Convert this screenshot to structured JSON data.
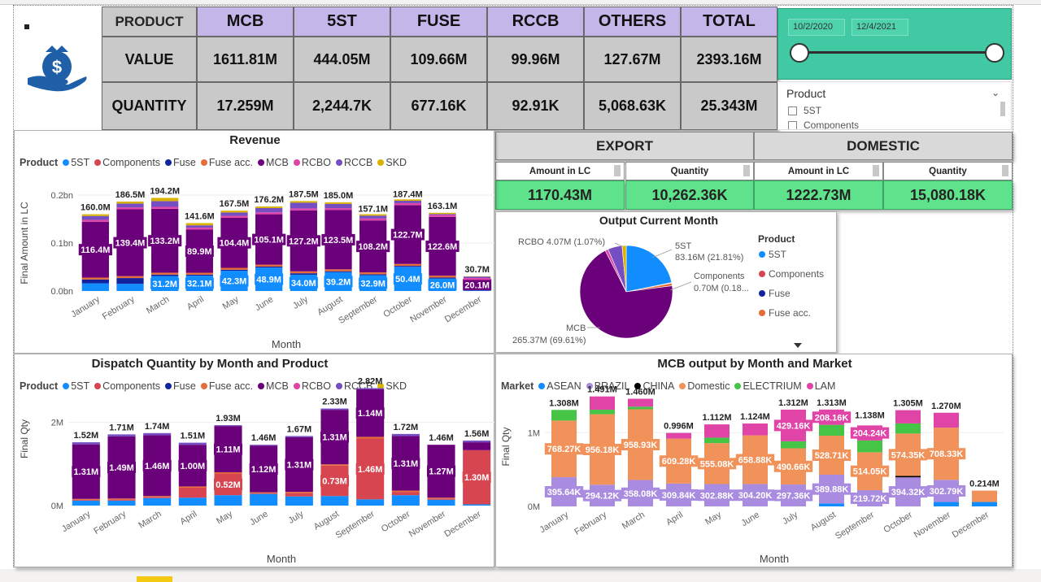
{
  "kpi": {
    "columns": [
      "PRODUCT",
      "MCB",
      "5ST",
      "FUSE",
      "RCCB",
      "OTHERS",
      "TOTAL"
    ],
    "rows": [
      {
        "label": "VALUE",
        "values": [
          "1611.81M",
          "444.05M",
          "109.66M",
          "99.96M",
          "127.67M",
          "2393.16M"
        ]
      },
      {
        "label": "QUANTITY",
        "values": [
          "17.259M",
          "2,244.7K",
          "677.16K",
          "92.91K",
          "5,068.63K",
          "25.343M"
        ]
      }
    ]
  },
  "date_slicer": {
    "start": "10/2/2020",
    "end": "12/4/2021"
  },
  "product_slicer": {
    "title": "Product",
    "items": [
      "5ST",
      "Components"
    ]
  },
  "export_domestic": {
    "export": {
      "title": "EXPORT",
      "amount_label": "Amount in LC",
      "quantity_label": "Quantity",
      "amount": "1170.43M",
      "quantity": "10,262.36K"
    },
    "domestic": {
      "title": "DOMESTIC",
      "amount_label": "Amount in LC",
      "quantity_label": "Quantity",
      "amount": "1222.73M",
      "quantity": "15,080.18K"
    }
  },
  "colors": {
    "5ST": "#118dff",
    "Components": "#d64550",
    "Fuse": "#12239e",
    "Fuse acc.": "#e66c37",
    "MCB": "#6b007b",
    "RCBO": "#e044a7",
    "RCCB": "#744ec2",
    "SKD": "#d9b300",
    "ASEAN": "#118dff",
    "BRAZIL": "#a98ce0",
    "CHINA": "#000000",
    "Domestic": "#f0925a",
    "ELECTRIUM": "#45c446",
    "LAM": "#e044a7"
  },
  "legend_product": {
    "title": "Product",
    "items": [
      "5ST",
      "Components",
      "Fuse",
      "Fuse acc.",
      "MCB",
      "RCBO",
      "RCCB",
      "SKD"
    ]
  },
  "legend_market": {
    "title": "Market",
    "items": [
      "ASEAN",
      "BRAZIL",
      "CHINA",
      "Domestic",
      "ELECTRIUM",
      "LAM"
    ]
  },
  "chart_data": [
    {
      "id": "revenue",
      "type": "bar",
      "title": "Revenue",
      "xlabel": "Month",
      "ylabel": "Final Amount in LC",
      "yticks": [
        "0.0bn",
        "0.1bn",
        "0.2bn"
      ],
      "ylim": [
        0,
        0.2
      ],
      "categories": [
        "January",
        "February",
        "March",
        "April",
        "May",
        "June",
        "July",
        "August",
        "September",
        "October",
        "November",
        "December"
      ],
      "totals": [
        "160.0M",
        "186.5M",
        "194.2M",
        "141.6M",
        "167.5M",
        "176.2M",
        "187.5M",
        "185.0M",
        "157.1M",
        "187.4M",
        "163.1M",
        "30.7M"
      ],
      "total_values": [
        0.16,
        0.1865,
        0.1942,
        0.1416,
        0.1675,
        0.1762,
        0.1875,
        0.185,
        0.1571,
        0.1874,
        0.1631,
        0.0307
      ],
      "series": [
        {
          "name": "5ST",
          "values": [
            0.016,
            0.015,
            0.0312,
            0.0321,
            0.0423,
            0.0489,
            0.034,
            0.0392,
            0.0329,
            0.0504,
            0.026,
            0.003
          ],
          "labels": [
            "",
            "",
            "31.2M",
            "32.1M",
            "42.3M",
            "48.9M",
            "34.0M",
            "39.2M",
            "32.9M",
            "50.4M",
            "26.0M",
            ""
          ]
        },
        {
          "name": "Fuse",
          "values": [
            0.008,
            0.012,
            0.003,
            0.002,
            0.002,
            0.002,
            0.003,
            0.002,
            0.002,
            0.002,
            0.002,
            0.0
          ],
          "labels": []
        },
        {
          "name": "Fuse acc.",
          "values": [
            0.004,
            0.004,
            0.004,
            0.004,
            0.004,
            0.004,
            0.004,
            0.004,
            0.004,
            0.004,
            0.004,
            0.0
          ],
          "labels": []
        },
        {
          "name": "MCB",
          "values": [
            0.1164,
            0.1394,
            0.1332,
            0.0899,
            0.1044,
            0.1051,
            0.1272,
            0.1235,
            0.1082,
            0.1227,
            0.1226,
            0.0201
          ],
          "labels": [
            "116.4M",
            "139.4M",
            "133.2M",
            "89.9M",
            "104.4M",
            "105.1M",
            "127.2M",
            "123.5M",
            "108.2M",
            "122.7M",
            "122.6M",
            "20.1M"
          ]
        },
        {
          "name": "RCBO",
          "values": [
            0.004,
            0.004,
            0.004,
            0.004,
            0.004,
            0.004,
            0.004,
            0.004,
            0.004,
            0.004,
            0.004,
            0.004
          ],
          "labels": []
        },
        {
          "name": "RCCB",
          "values": [
            0.008,
            0.008,
            0.012,
            0.005,
            0.007,
            0.009,
            0.012,
            0.009,
            0.006,
            0.005,
            0.002,
            0.003
          ],
          "labels": []
        },
        {
          "name": "SKD",
          "values": [
            0.0036,
            0.0041,
            0.0068,
            0.0046,
            0.0038,
            0.0032,
            0.0033,
            0.0033,
            0.003,
            0.0029,
            0.0025,
            0.0006
          ],
          "labels": []
        }
      ]
    },
    {
      "id": "dispatch",
      "type": "bar",
      "title": "Dispatch Quantity by Month and Product",
      "xlabel": "Month",
      "ylabel": "Final Qty",
      "yticks": [
        "0M",
        "2M"
      ],
      "ylim": [
        0,
        3.2
      ],
      "categories": [
        "January",
        "February",
        "March",
        "April",
        "May",
        "June",
        "July",
        "August",
        "September",
        "October",
        "November",
        "December"
      ],
      "totals": [
        "1.52M",
        "1.71M",
        "1.74M",
        "1.51M",
        "1.93M",
        "1.46M",
        "1.67M",
        "2.33M",
        "2.82M",
        "1.72M",
        "1.46M",
        "1.56M"
      ],
      "total_values": [
        1.52,
        1.71,
        1.74,
        1.51,
        1.93,
        1.46,
        1.67,
        2.33,
        2.82,
        1.72,
        1.46,
        1.56
      ],
      "series": [
        {
          "name": "5ST",
          "values": [
            0.12,
            0.12,
            0.18,
            0.19,
            0.25,
            0.28,
            0.22,
            0.23,
            0.15,
            0.25,
            0.14,
            0.03
          ],
          "labels": []
        },
        {
          "name": "Components",
          "values": [
            0.02,
            0.03,
            0.03,
            0.24,
            0.52,
            0.02,
            0.08,
            0.73,
            1.46,
            0.08,
            0.03,
            1.3
          ],
          "labels": [
            "",
            "",
            "",
            "",
            "0.52M",
            "",
            "",
            "0.73M",
            "1.46M",
            "",
            "",
            "1.30M"
          ]
        },
        {
          "name": "Fuse acc.",
          "values": [
            0.02,
            0.02,
            0.02,
            0.03,
            0.03,
            0.02,
            0.03,
            0.03,
            0.04,
            0.03,
            0.02,
            0.0
          ],
          "labels": []
        },
        {
          "name": "MCB",
          "values": [
            1.31,
            1.49,
            1.46,
            1.0,
            1.11,
            1.12,
            1.31,
            1.31,
            1.14,
            1.31,
            1.27,
            0.19
          ],
          "labels": [
            "1.31M",
            "1.49M",
            "1.46M",
            "1.00M",
            "1.11M",
            "1.12M",
            "1.31M",
            "1.31M",
            "1.14M",
            "1.31M",
            "1.27M",
            ""
          ]
        },
        {
          "name": "RCCB",
          "values": [
            0.05,
            0.05,
            0.05,
            0.05,
            0.02,
            0.02,
            0.03,
            0.03,
            0.03,
            0.05,
            0.0,
            0.04
          ],
          "labels": []
        }
      ]
    },
    {
      "id": "mcb_market",
      "type": "bar",
      "title": "MCB output by Month and Market",
      "xlabel": "Month",
      "ylabel": "Final Qty",
      "yticks": [
        "0M",
        "1M"
      ],
      "ylim": [
        0,
        1.62
      ],
      "categories": [
        "January",
        "February",
        "March",
        "April",
        "May",
        "June",
        "July",
        "August",
        "September",
        "October",
        "November",
        "December"
      ],
      "totals": [
        "1.308M",
        "1.491M",
        "1.460M",
        "0.996M",
        "1.112M",
        "1.124M",
        "1.312M",
        "1.313M",
        "1.138M",
        "1.305M",
        "1.270M",
        "0.214M"
      ],
      "total_values": [
        1.308,
        1.491,
        1.46,
        0.996,
        1.112,
        1.124,
        1.312,
        1.313,
        1.138,
        1.305,
        1.27,
        0.214
      ],
      "series": [
        {
          "name": "ASEAN",
          "values": [
            0.0,
            0.0,
            0.0,
            0.0,
            0.0,
            0.0,
            0.0,
            0.04,
            0.0,
            0.0,
            0.06,
            0.06
          ],
          "labels": []
        },
        {
          "name": "BRAZIL",
          "values": [
            0.396,
            0.294,
            0.358,
            0.31,
            0.303,
            0.304,
            0.297,
            0.39,
            0.22,
            0.394,
            0.3,
            0.0
          ],
          "labels": [
            "395.64K",
            "294.12K",
            "358.08K",
            "309.84K",
            "302.88K",
            "304.20K",
            "297.36K",
            "389.88K",
            "219.72K",
            "394.32K",
            "302.79K",
            ""
          ]
        },
        {
          "name": "CHINA",
          "values": [
            0.0,
            0.0,
            0.0,
            0.0,
            0.0,
            0.0,
            0.0,
            0.0,
            0.0,
            0.02,
            0.0,
            0.0
          ],
          "labels": []
        },
        {
          "name": "Domestic",
          "values": [
            0.768,
            0.956,
            0.959,
            0.609,
            0.555,
            0.659,
            0.491,
            0.529,
            0.514,
            0.574,
            0.708,
            0.154
          ],
          "labels": [
            "768.27K",
            "956.18K",
            "958.93K",
            "609.28K",
            "555.08K",
            "658.88K",
            "490.66K",
            "528.71K",
            "514.05K",
            "574.35K",
            "708.33K",
            ""
          ]
        },
        {
          "name": "ELECTRIUM",
          "values": [
            0.144,
            0.061,
            0.035,
            0.0,
            0.074,
            0.0,
            0.095,
            0.146,
            0.16,
            0.137,
            0.0,
            0.0
          ],
          "labels": []
        },
        {
          "name": "LAM",
          "values": [
            0.0,
            0.18,
            0.108,
            0.077,
            0.18,
            0.161,
            0.429,
            0.208,
            0.204,
            0.18,
            0.202,
            0.0
          ],
          "labels": [
            "",
            "",
            "",
            "",
            "",
            "",
            "429.16K",
            "208.16K",
            "204.24K",
            "",
            "",
            ""
          ]
        }
      ]
    },
    {
      "id": "output_month",
      "type": "pie",
      "title": "Output Current Month",
      "legend_title": "Product",
      "legend_items": [
        "5ST",
        "Components",
        "Fuse",
        "Fuse acc."
      ],
      "slices": [
        {
          "name": "5ST",
          "value": 83.16,
          "pct": 21.81,
          "label_a": "5ST",
          "label_b": "83.16M (21.81%)"
        },
        {
          "name": "Components",
          "value": 0.7,
          "pct": 0.18,
          "label_a": "Components",
          "label_b": "0.70M (0.18..."
        },
        {
          "name": "Fuse acc.",
          "value": 3.5,
          "pct": 0.92,
          "label_a": "",
          "label_b": ""
        },
        {
          "name": "MCB",
          "value": 265.37,
          "pct": 69.61,
          "label_a": "MCB",
          "label_b": "265.37M (69.61%)"
        },
        {
          "name": "RCBO",
          "value": 4.07,
          "pct": 1.07,
          "label_a": "RCBO 4.07M (1.07%)",
          "label_b": ""
        },
        {
          "name": "RCCB",
          "value": 19.0,
          "pct": 4.98,
          "label_a": "",
          "label_b": ""
        },
        {
          "name": "SKD",
          "value": 5.5,
          "pct": 1.44,
          "label_a": "",
          "label_b": ""
        }
      ]
    }
  ]
}
